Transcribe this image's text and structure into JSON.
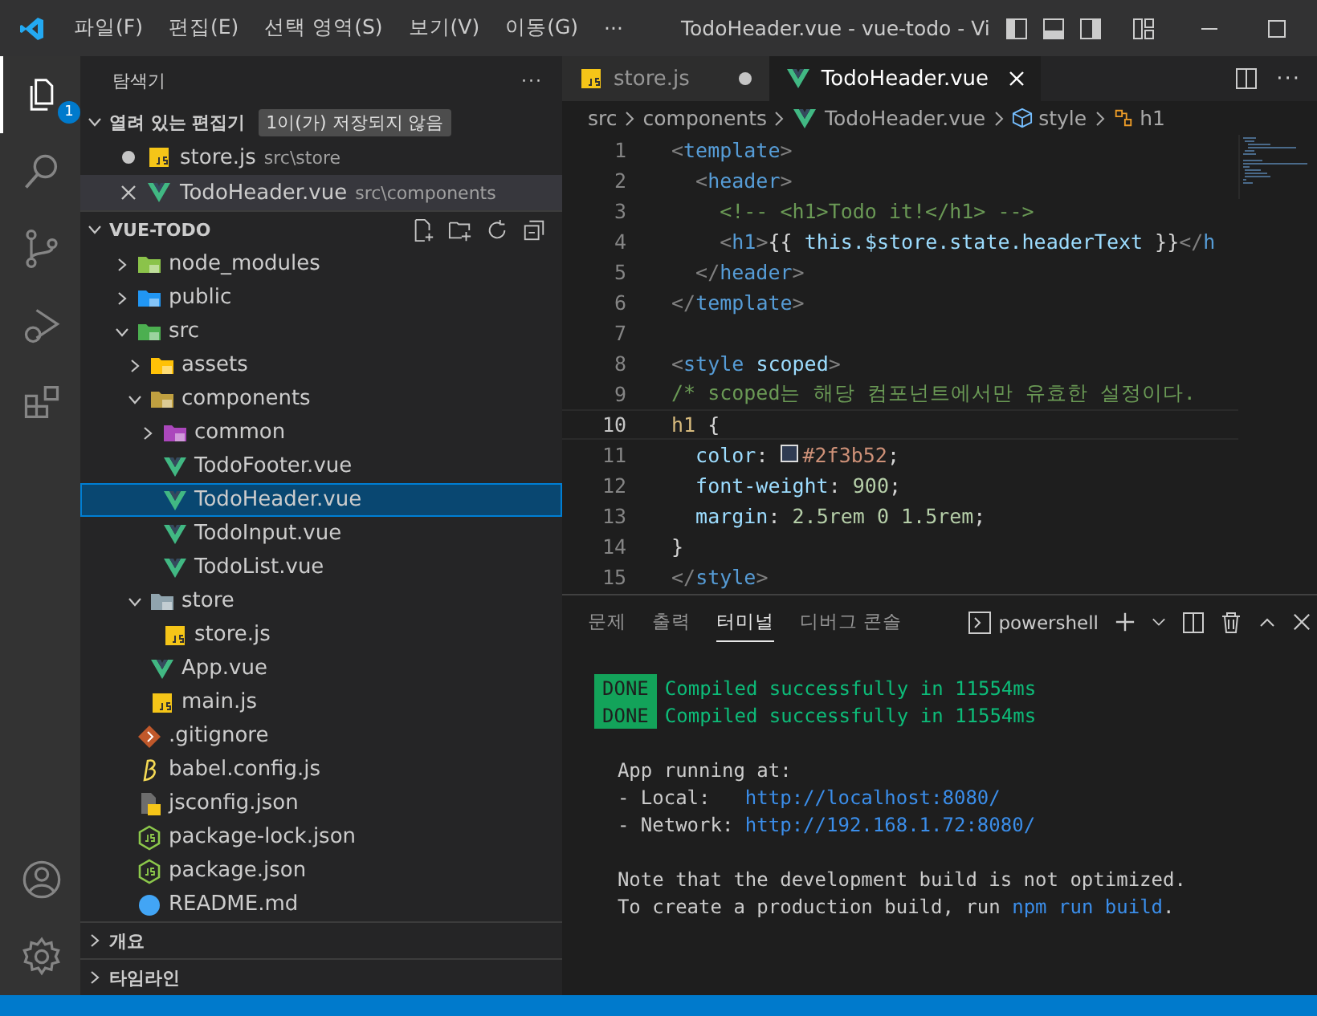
{
  "title_bar": {
    "menus": [
      "파일(F)",
      "편집(E)",
      "선택 영역(S)",
      "보기(V)",
      "이동(G)"
    ],
    "overflow": "···",
    "title": "TodoHeader.vue - vue-todo - Vi"
  },
  "activity_bar": {
    "items": [
      {
        "kind": "files",
        "selected": true,
        "badge": "1"
      },
      {
        "kind": "search",
        "selected": false
      },
      {
        "kind": "source-control",
        "selected": false
      },
      {
        "kind": "run-debug",
        "selected": false
      },
      {
        "kind": "extensions",
        "selected": false
      }
    ],
    "bottom": [
      {
        "kind": "account"
      },
      {
        "kind": "settings"
      }
    ]
  },
  "sidebar": {
    "title": "탐색기",
    "more": "···",
    "open_editors": {
      "title": "열려 있는 편집기",
      "badge": "1이(가) 저장되지 않음",
      "expanded": true,
      "items": [
        {
          "name": "store.js",
          "path": "src\\store",
          "kind": "js",
          "modified": true,
          "active": false
        },
        {
          "name": "TodoHeader.vue",
          "path": "src\\components",
          "kind": "vue",
          "modified": false,
          "active": true
        }
      ]
    },
    "project": {
      "title": "VUE-TODO",
      "expanded": true,
      "tree": [
        {
          "name": "node_modules",
          "kind": "node-folder",
          "expanded": false,
          "selected": false
        },
        {
          "name": "public",
          "kind": "public-folder",
          "expanded": false,
          "selected": false
        },
        {
          "name": "src",
          "kind": "src-folder",
          "expanded": true,
          "selected": false,
          "children": [
            {
              "name": "assets",
              "kind": "assets-folder",
              "expanded": false,
              "selected": false
            },
            {
              "name": "components",
              "kind": "components-folder",
              "expanded": true,
              "selected": false,
              "children": [
                {
                  "name": "common",
                  "kind": "common-folder",
                  "expanded": false,
                  "selected": false
                },
                {
                  "name": "TodoFooter.vue",
                  "kind": "vue",
                  "selected": false
                },
                {
                  "name": "TodoHeader.vue",
                  "kind": "vue",
                  "selected": true
                },
                {
                  "name": "TodoInput.vue",
                  "kind": "vue",
                  "selected": false
                },
                {
                  "name": "TodoList.vue",
                  "kind": "vue",
                  "selected": false
                }
              ]
            },
            {
              "name": "store",
              "kind": "folder",
              "expanded": true,
              "selected": false,
              "children": [
                {
                  "name": "store.js",
                  "kind": "js",
                  "selected": false
                }
              ]
            },
            {
              "name": "App.vue",
              "kind": "vue",
              "selected": false
            },
            {
              "name": "main.js",
              "kind": "js",
              "selected": false
            }
          ]
        },
        {
          "name": ".gitignore",
          "kind": "git",
          "selected": false
        },
        {
          "name": "babel.config.js",
          "kind": "babel",
          "selected": false
        },
        {
          "name": "jsconfig.json",
          "kind": "jsconfig",
          "selected": false
        },
        {
          "name": "package-lock.json",
          "kind": "node",
          "selected": false
        },
        {
          "name": "package.json",
          "kind": "node",
          "selected": false
        },
        {
          "name": "README.md",
          "kind": "info",
          "selected": false
        }
      ]
    },
    "sections": [
      {
        "title": "개요",
        "expanded": false
      },
      {
        "title": "타임라인",
        "expanded": false
      }
    ]
  },
  "editor": {
    "tabs": [
      {
        "name": "store.js",
        "kind": "js",
        "selected": false,
        "modified": true
      },
      {
        "name": "TodoHeader.vue",
        "kind": "vue",
        "selected": true,
        "modified": false
      }
    ],
    "breadcrumb": [
      {
        "text": "src",
        "kind": "plain"
      },
      {
        "text": "components",
        "kind": "plain"
      },
      {
        "text": "TodoHeader.vue",
        "kind": "vue"
      },
      {
        "text": "style",
        "kind": "style"
      },
      {
        "text": "h1",
        "kind": "selector"
      }
    ],
    "lines": [
      {
        "number": "1",
        "current": false,
        "tokens": [
          {
            "text": "<",
            "kind": "punct"
          },
          {
            "text": "template",
            "kind": "tag"
          },
          {
            "text": ">",
            "kind": "punct"
          }
        ]
      },
      {
        "number": "2",
        "current": false,
        "tokens": [
          {
            "text": "  <",
            "kind": "punct"
          },
          {
            "text": "header",
            "kind": "tag"
          },
          {
            "text": ">",
            "kind": "punct"
          }
        ]
      },
      {
        "number": "3",
        "current": false,
        "tokens": [
          {
            "text": "    <!-- <h1>Todo it!</h1> -->",
            "kind": "comment"
          }
        ]
      },
      {
        "number": "4",
        "current": false,
        "tokens": [
          {
            "text": "    <",
            "kind": "punct"
          },
          {
            "text": "h1",
            "kind": "tag"
          },
          {
            "text": ">",
            "kind": "punct"
          },
          {
            "text": "{{ ",
            "kind": "text"
          },
          {
            "text": "this.$store.state.headerText",
            "kind": "attr"
          },
          {
            "text": " }}",
            "kind": "text"
          },
          {
            "text": "</",
            "kind": "punct"
          },
          {
            "text": "h",
            "kind": "tag"
          }
        ]
      },
      {
        "number": "5",
        "current": false,
        "tokens": [
          {
            "text": "  </",
            "kind": "punct"
          },
          {
            "text": "header",
            "kind": "tag"
          },
          {
            "text": ">",
            "kind": "punct"
          }
        ]
      },
      {
        "number": "6",
        "current": false,
        "tokens": [
          {
            "text": "</",
            "kind": "punct"
          },
          {
            "text": "template",
            "kind": "tag"
          },
          {
            "text": ">",
            "kind": "punct"
          }
        ]
      },
      {
        "number": "7",
        "current": false
      },
      {
        "number": "8",
        "current": false,
        "tokens": [
          {
            "text": "<",
            "kind": "punct"
          },
          {
            "text": "style",
            "kind": "tag"
          },
          {
            "text": " scoped",
            "kind": "attr"
          },
          {
            "text": ">",
            "kind": "punct"
          }
        ]
      },
      {
        "number": "9",
        "current": false,
        "tokens": [
          {
            "text": "/* scoped는 해당 컴포넌트에서만 유효한 설정이다.",
            "kind": "comment"
          }
        ]
      },
      {
        "number": "10",
        "current": true,
        "tokens": [
          {
            "text": "h1",
            "kind": "selector"
          },
          {
            "text": " {",
            "kind": "text"
          }
        ]
      },
      {
        "number": "11",
        "current": false,
        "tokens": [
          {
            "text": "  color",
            "kind": "attr"
          },
          {
            "text": ": ",
            "kind": "text"
          },
          {
            "text": "#2f3b52",
            "kind": "value",
            "color": "#2f3b52"
          },
          {
            "text": ";",
            "kind": "text"
          }
        ]
      },
      {
        "number": "12",
        "current": false,
        "tokens": [
          {
            "text": "  font-weight",
            "kind": "attr"
          },
          {
            "text": ": ",
            "kind": "text"
          },
          {
            "text": "900",
            "kind": "number"
          },
          {
            "text": ";",
            "kind": "text"
          }
        ]
      },
      {
        "number": "13",
        "current": false,
        "tokens": [
          {
            "text": "  margin",
            "kind": "attr"
          },
          {
            "text": ": ",
            "kind": "text"
          },
          {
            "text": "2.5rem 0 1.5rem",
            "kind": "number"
          },
          {
            "text": ";",
            "kind": "text"
          }
        ]
      },
      {
        "number": "14",
        "current": false,
        "tokens": [
          {
            "text": "}",
            "kind": "text"
          }
        ]
      },
      {
        "number": "15",
        "current": false,
        "tokens": [
          {
            "text": "</",
            "kind": "punct"
          },
          {
            "text": "style",
            "kind": "tag"
          },
          {
            "text": ">",
            "kind": "punct"
          }
        ]
      }
    ]
  },
  "panel": {
    "tabs": [
      {
        "label": "문제",
        "selected": false
      },
      {
        "label": "출력",
        "selected": false
      },
      {
        "label": "터미널",
        "selected": true
      },
      {
        "label": "디버그 콘솔",
        "selected": false
      }
    ],
    "terminal_name": "powershell",
    "lines": [
      {
        "kind": "done",
        "badge": "DONE",
        "text": "Compiled successfully in 11554ms"
      },
      {
        "kind": "done",
        "badge": "DONE",
        "text": "Compiled successfully in 11554ms"
      },
      {
        "kind": "blank"
      },
      {
        "kind": "plain",
        "text": "  App running at:"
      },
      {
        "kind": "link",
        "text": "  - Local:   ",
        "link": "http://localhost:8080/"
      },
      {
        "kind": "link",
        "text": "  - Network: ",
        "link": "http://192.168.1.72:8080/"
      },
      {
        "kind": "blank"
      },
      {
        "kind": "plain",
        "text": "  Note that the development build is not optimized."
      },
      {
        "kind": "link",
        "text": "  To create a production build, run ",
        "link": "npm run build",
        "after": "."
      }
    ]
  }
}
